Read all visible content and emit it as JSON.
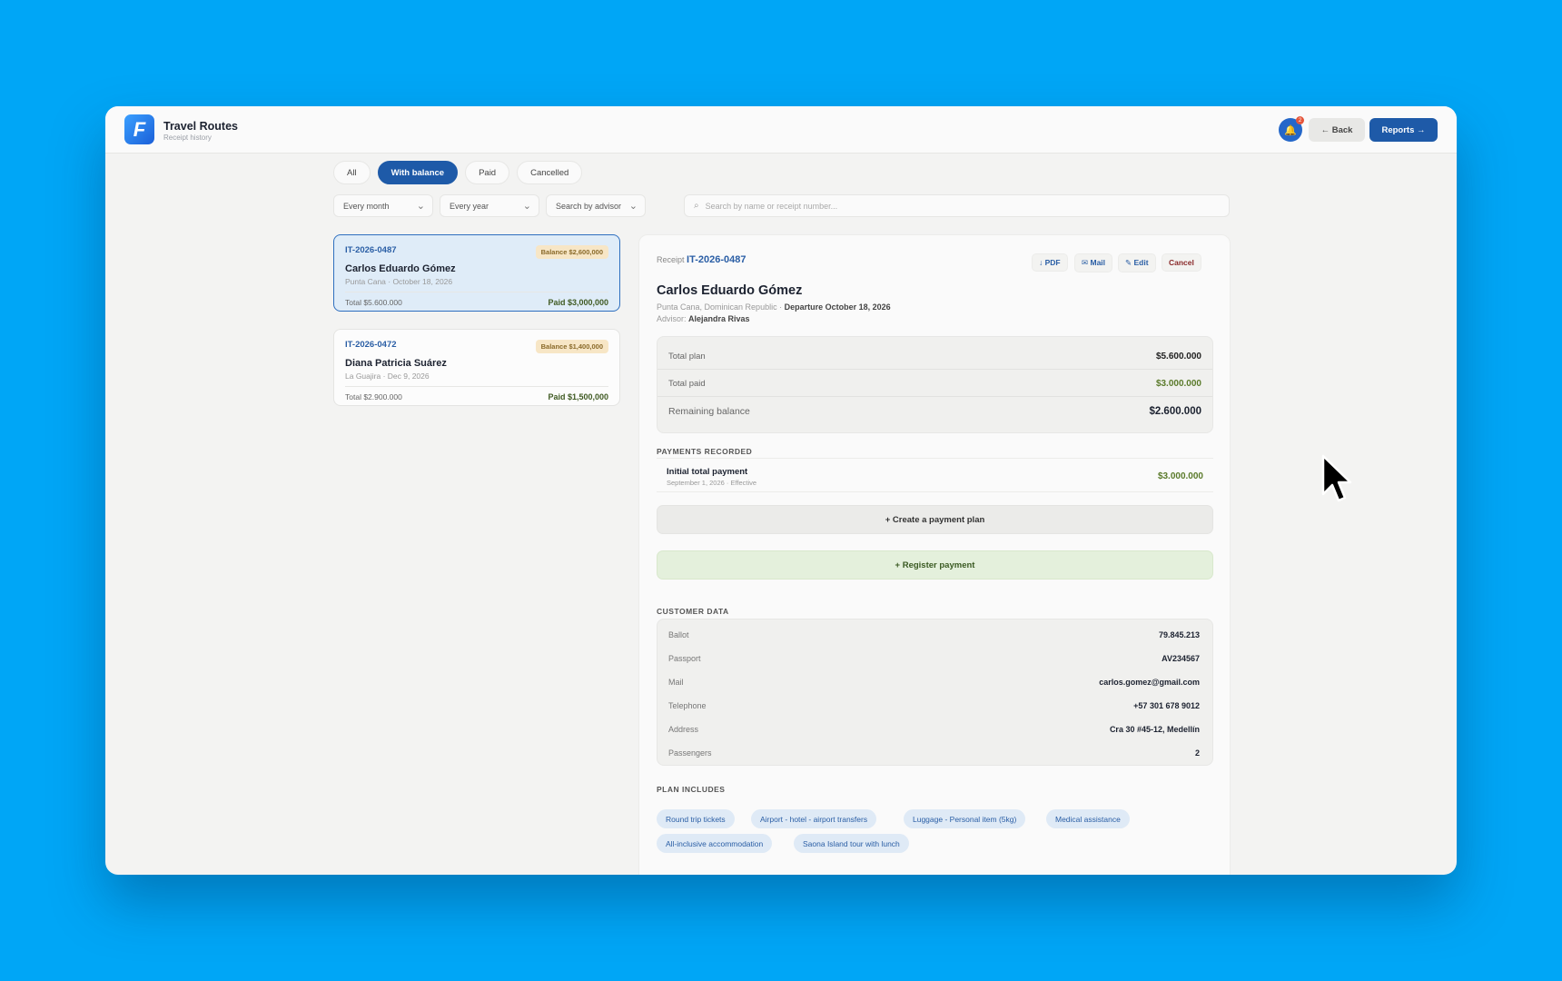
{
  "app": {
    "title": "Travel Routes",
    "subtitle": "Receipt history",
    "logo_letter": "F"
  },
  "header": {
    "notification_count": "2",
    "back_label": "← Back",
    "reports_label": "Reports →"
  },
  "tabs": [
    {
      "label": "All"
    },
    {
      "label": "With balance",
      "active": true
    },
    {
      "label": "Paid"
    },
    {
      "label": "Cancelled"
    }
  ],
  "filters": {
    "month": "Every month",
    "year": "Every year",
    "advisor": "Search by advisor",
    "search_placeholder": "Search by name or receipt number..."
  },
  "receipts": [
    {
      "id": "IT-2026-0487",
      "balance": "Balance $2,600,000",
      "name": "Carlos Eduardo Gómez",
      "location": "Punta Cana · October 18, 2026",
      "total": "Total $5.600.000",
      "paid": "Paid $3,000,000",
      "selected": true
    },
    {
      "id": "IT-2026-0472",
      "balance": "Balance $1,400,000",
      "name": "Diana Patricia Suárez",
      "location": "La Guajira · Dec 9, 2026",
      "total": "Total $2.900.000",
      "paid": "Paid $1,500,000",
      "selected": false
    }
  ],
  "detail": {
    "receipt_label": "Receipt",
    "receipt_id": "IT-2026-0487",
    "actions": {
      "pdf": "↓ PDF",
      "mail": "✉ Mail",
      "edit": "✎ Edit",
      "cancel": "Cancel"
    },
    "name": "Carlos Eduardo Gómez",
    "destination": "Punta Cana, Dominican Republic · ",
    "departure": "Departure October 18, 2026",
    "advisor_label": "Advisor: ",
    "advisor": "Alejandra Rivas",
    "summary": {
      "total_plan_label": "Total plan",
      "total_plan": "$5.600.000",
      "total_paid_label": "Total paid",
      "total_paid": "$3.000.000",
      "remaining_label": "Remaining balance",
      "remaining": "$2.600.000"
    },
    "payments_title": "PAYMENTS RECORDED",
    "payments": [
      {
        "name": "Initial total payment",
        "date": "September 1, 2026 · Effective",
        "amount": "$3.000.000"
      }
    ],
    "create_plan_label": "+ Create a payment plan",
    "register_payment_label": "+ Register payment",
    "customer_title": "CUSTOMER DATA",
    "customer": [
      {
        "label": "Ballot",
        "value": "79.845.213"
      },
      {
        "label": "Passport",
        "value": "AV234567"
      },
      {
        "label": "Mail",
        "value": "carlos.gomez@gmail.com"
      },
      {
        "label": "Telephone",
        "value": "+57 301 678 9012"
      },
      {
        "label": "Address",
        "value": "Cra 30 #45-12, Medellín"
      },
      {
        "label": "Passengers",
        "value": "2"
      }
    ],
    "includes_title": "PLAN INCLUDES",
    "includes": [
      "Round trip tickets",
      "Airport - hotel - airport transfers",
      "Luggage - Personal item (5kg)",
      "Medical assistance",
      "All-inclusive accommodation",
      "Saona Island tour with lunch"
    ]
  },
  "colors": {
    "background": "#00a6f6",
    "primary": "#1e5aa8",
    "balance_badge": "#f7e6c6",
    "paid_green": "#5a7a2a"
  }
}
